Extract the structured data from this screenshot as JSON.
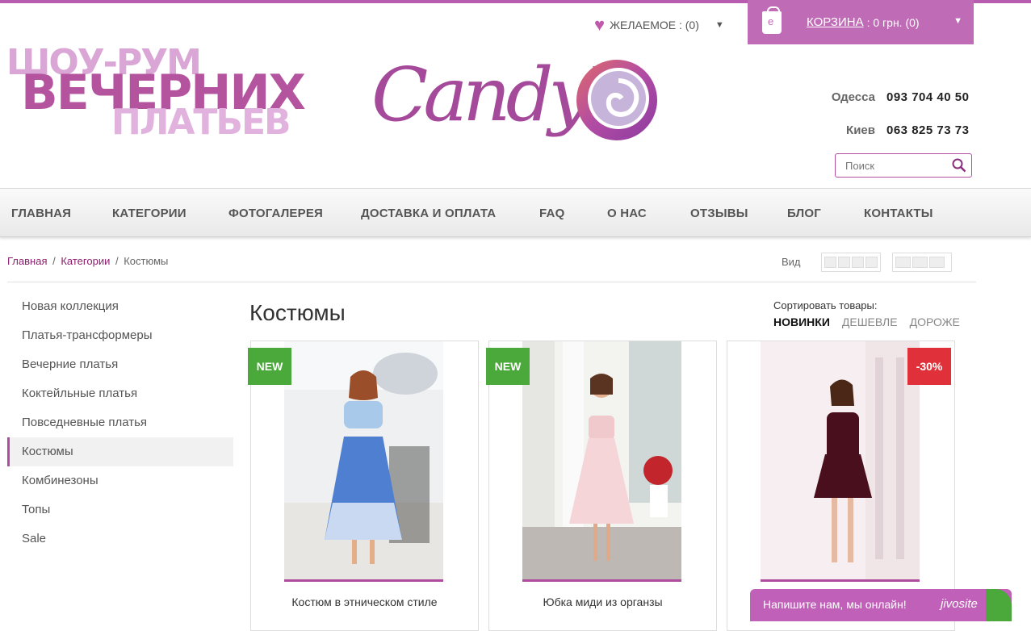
{
  "header": {
    "slogan": [
      "ШОУ-РУМ",
      "ВЕЧЕРНИХ",
      "ПЛАТЬЕВ"
    ],
    "logo_text": "Candy's",
    "wishlist": {
      "label": "ЖЕЛАЕМОЕ : (0)"
    },
    "cart": {
      "label": "КОРЗИНА",
      "sum": ": 0 грн. (0)"
    },
    "phones": [
      {
        "city": "Одесса",
        "number": "093 704 40 50"
      },
      {
        "city": "Киев",
        "number": "063 825 73 73"
      }
    ],
    "search": {
      "placeholder": "Поиск",
      "value": ""
    }
  },
  "nav": [
    "ГЛАВНАЯ",
    "КАТЕГОРИИ",
    "ФОТОГАЛЕРЕЯ",
    "ДОСТАВКА И ОПЛАТА",
    "FAQ",
    "О НАС",
    "ОТЗЫВЫ",
    "БЛОГ",
    "КОНТАКТЫ"
  ],
  "breadcrumb": {
    "home": "Главная",
    "sep": "/",
    "categories": "Категории",
    "current": "Костюмы"
  },
  "view": {
    "label": "Вид"
  },
  "sidebar": [
    "Новая коллекция",
    "Платья-трансформеры",
    "Вечерние платья",
    "Коктейльные платья",
    "Повседневные платья",
    "Костюмы",
    "Комбинезоны",
    "Топы",
    "Sale"
  ],
  "sidebar_active": "Костюмы",
  "main": {
    "title": "Костюмы",
    "sort_label": "Сортировать товары:",
    "sort_options": [
      "НОВИНКИ",
      "ДЕШЕВЛЕ",
      "ДОРОЖЕ"
    ],
    "sort_active": "НОВИНКИ"
  },
  "products": [
    {
      "name": "Костюм в этническом стиле",
      "badge": "NEW"
    },
    {
      "name": "Юбка миди из органзы",
      "badge": "NEW"
    },
    {
      "name": "",
      "badge": "-30%"
    }
  ],
  "chat": {
    "text": "Напишите нам, мы онлайн!",
    "brand": "jivosite"
  },
  "colors": {
    "accent": "#b04c9e",
    "cart_bg": "#c06bb6",
    "new_badge": "#4aa93a",
    "sale_badge": "#e0303a"
  }
}
